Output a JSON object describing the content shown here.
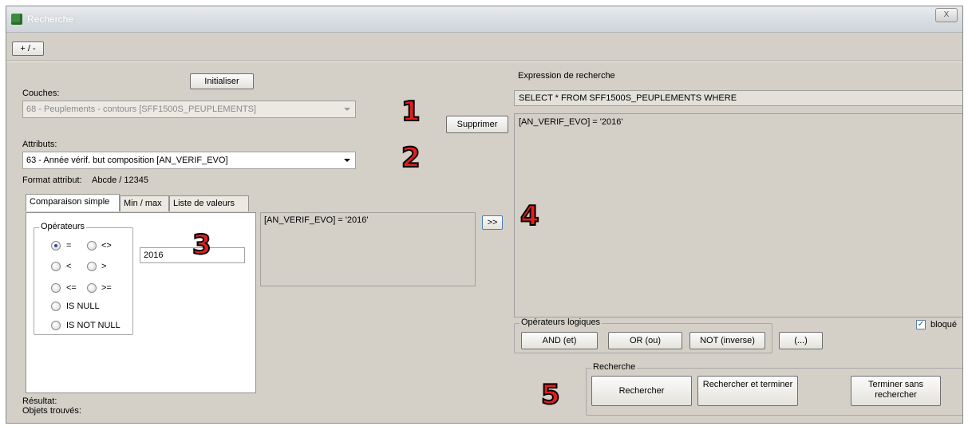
{
  "window": {
    "title": "Recherche",
    "close_label": "X"
  },
  "toggle_button": "+ / -",
  "left": {
    "init_button": "Initialiser",
    "couches_label": "Couches:",
    "couches_value": "68 - Peuplements - contours [SFF1500S_PEUPLEMENTS]",
    "attributs_label": "Attributs:",
    "attributs_value": "63 - Année vérif. but composition [AN_VERIF_EVO]",
    "format_label": "Format attribut:",
    "format_value": "Abcde / 12345",
    "tabs": [
      {
        "label": "Comparaison simple"
      },
      {
        "label": "Min / max"
      },
      {
        "label": "Liste de valeurs"
      }
    ],
    "operators_title": "Opérateurs",
    "operators": [
      "=",
      "<>",
      "<",
      ">",
      "<=",
      ">=",
      "IS NULL",
      "IS NOT NULL"
    ],
    "value_input": "2016",
    "preview_text": "[AN_VERIF_EVO] = '2016'",
    "add_button": ">>",
    "result_label": "Résultat:",
    "objects_label": "Objets trouvés:"
  },
  "middle": {
    "delete_button": "Supprimer"
  },
  "right": {
    "expression_label": "Expression de recherche",
    "sql_header": "SELECT * FROM SFF1500S_PEUPLEMENTS WHERE",
    "expression_text": "[AN_VERIF_EVO] = '2016'",
    "logic_title": "Opérateurs logiques",
    "logic_buttons": [
      "AND (et)",
      "OR (ou)",
      "NOT (inverse)",
      "(...)"
    ],
    "locked_label": "bloqué",
    "locked_checked": true,
    "search_title": "Recherche",
    "search_buttons": [
      "Rechercher",
      "Rechercher et terminer",
      "Terminer sans rechercher"
    ]
  },
  "markers": [
    "1",
    "2",
    "3",
    "4",
    "5"
  ]
}
